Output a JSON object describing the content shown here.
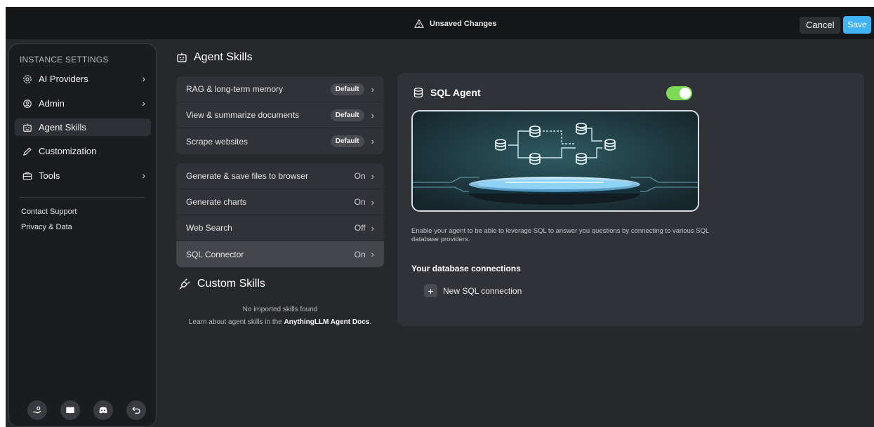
{
  "topbar": {
    "unsaved_label": "Unsaved Changes",
    "cancel_label": "Cancel",
    "save_label": "Save"
  },
  "sidebar": {
    "title": "INSTANCE SETTINGS",
    "items": [
      {
        "label": "AI Providers",
        "icon": "gear-icon",
        "has_chevron": true
      },
      {
        "label": "Admin",
        "icon": "user-gear-icon",
        "has_chevron": true
      },
      {
        "label": "Agent Skills",
        "icon": "robot-icon",
        "active": true
      },
      {
        "label": "Customization",
        "icon": "brush-icon"
      },
      {
        "label": "Tools",
        "icon": "toolbox-icon",
        "has_chevron": true
      }
    ],
    "links": [
      "Contact Support",
      "Privacy & Data"
    ],
    "footer_icons": [
      "support-hand-icon",
      "book-icon",
      "discord-icon",
      "return-icon"
    ]
  },
  "main": {
    "title": "Agent Skills",
    "default_skills": [
      {
        "label": "RAG & long-term memory",
        "badge": "Default"
      },
      {
        "label": "View & summarize documents",
        "badge": "Default"
      },
      {
        "label": "Scrape websites",
        "badge": "Default"
      }
    ],
    "configurable_skills": [
      {
        "label": "Generate & save files to browser",
        "state": "On"
      },
      {
        "label": "Generate charts",
        "state": "On"
      },
      {
        "label": "Web Search",
        "state": "Off"
      },
      {
        "label": "SQL Connector",
        "state": "On",
        "selected": true
      }
    ],
    "custom_title": "Custom Skills",
    "no_skills": "No imported skills found",
    "docs_prefix": "Learn about agent skills in the ",
    "docs_link": "AnythingLLM Agent Docs",
    "docs_suffix": "."
  },
  "detail": {
    "title": "SQL Agent",
    "enabled": true,
    "description": "Enable your agent to be able to leverage SQL to answer you questions by connecting to various SQL database providers.",
    "connections_title": "Your database connections",
    "new_connection_label": "New SQL connection"
  },
  "colors": {
    "accent_blue": "#3fb3f4",
    "toggle_on": "#7ed957",
    "background": "#27282c",
    "panel": "#313237"
  }
}
